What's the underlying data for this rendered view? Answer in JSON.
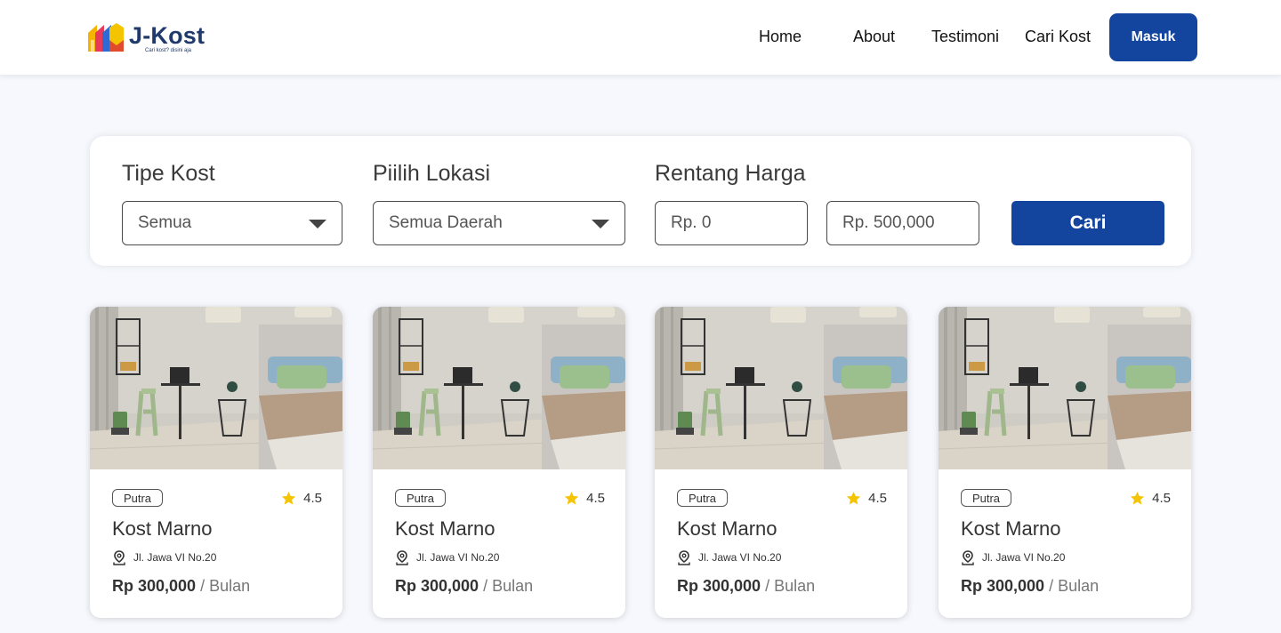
{
  "brand": {
    "name": "J-Kost",
    "tagline": "Cari kost? disini aja"
  },
  "nav": {
    "items": [
      {
        "label": "Home"
      },
      {
        "label": "About"
      },
      {
        "label": "Testimoni"
      },
      {
        "label": "Cari Kost"
      }
    ],
    "login_label": "Masuk"
  },
  "filter": {
    "type_label": "Tipe Kost",
    "type_value": "Semua",
    "location_label": "Piilih Lokasi",
    "location_value": "Semua Daerah",
    "price_label": "Rentang Harga",
    "price_min": "Rp. 0",
    "price_max": "Rp. 500,000",
    "search_label": "Cari"
  },
  "listings": [
    {
      "type": "Putra",
      "rating": "4.5",
      "name": "Kost Marno",
      "address": "Jl. Jawa VI No.20",
      "price": "Rp 300,000",
      "unit": "/ Bulan"
    },
    {
      "type": "Putra",
      "rating": "4.5",
      "name": "Kost Marno",
      "address": "Jl. Jawa VI No.20",
      "price": "Rp 300,000",
      "unit": "/ Bulan"
    },
    {
      "type": "Putra",
      "rating": "4.5",
      "name": "Kost Marno",
      "address": "Jl. Jawa VI No.20",
      "price": "Rp 300,000",
      "unit": "/ Bulan"
    },
    {
      "type": "Putra",
      "rating": "4.5",
      "name": "Kost Marno",
      "address": "Jl. Jawa VI No.20",
      "price": "Rp 300,000",
      "unit": "/ Bulan"
    }
  ],
  "colors": {
    "primary": "#13459f",
    "brand_text": "#1f3a6b",
    "star": "#f5c400",
    "page_bg": "#f6f8fd"
  }
}
